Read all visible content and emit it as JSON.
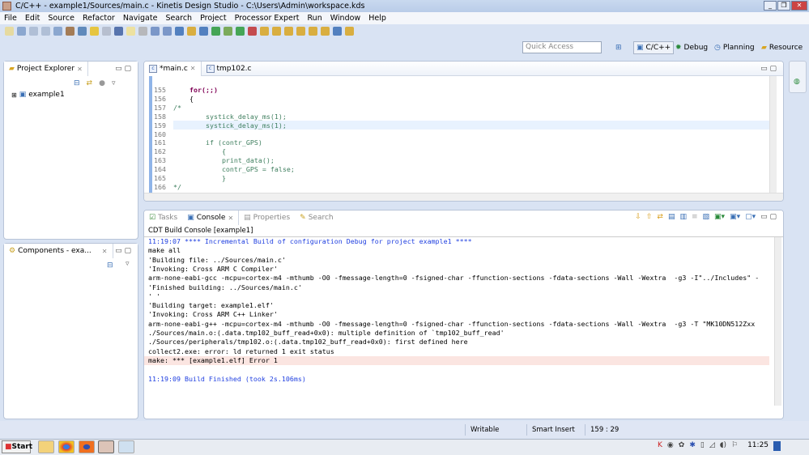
{
  "window": {
    "title": "C/C++ - example1/Sources/main.c - Kinetis Design Studio - C:\\Users\\Admin\\workspace.kds"
  },
  "menu": [
    "File",
    "Edit",
    "Source",
    "Refactor",
    "Navigate",
    "Search",
    "Project",
    "Processor Expert",
    "Run",
    "Window",
    "Help"
  ],
  "quick_access": {
    "placeholder": "Quick Access"
  },
  "perspectives": [
    {
      "label": "C/C++",
      "icon": "cpp-perspective-icon",
      "active": true
    },
    {
      "label": "Debug",
      "icon": "bug-icon"
    },
    {
      "label": "Planning",
      "icon": "clock-icon"
    },
    {
      "label": "Resource",
      "icon": "folder-icon"
    }
  ],
  "project_explorer": {
    "title": "Project Explorer",
    "items": [
      {
        "label": "example1",
        "expanded": false,
        "has_error": true
      }
    ]
  },
  "components": {
    "title": "Components - exa..."
  },
  "editor": {
    "tabs": [
      {
        "label": "*main.c",
        "active": true
      },
      {
        "label": "tmp102.c",
        "active": false
      }
    ],
    "lines": [
      {
        "n": "155",
        "text": "    for(;;)",
        "style": "kw"
      },
      {
        "n": "156",
        "text": "    {",
        "style": "pl"
      },
      {
        "n": "157",
        "text": "/*",
        "style": "cm"
      },
      {
        "n": "158",
        "text": "        systick_delay_ms(1);",
        "style": "cm"
      },
      {
        "n": "159",
        "text": "        systick_delay_ms(1);",
        "style": "cm"
      },
      {
        "n": "160",
        "text": "",
        "style": "cm"
      },
      {
        "n": "161",
        "text": "        if (contr_GPS)",
        "style": "cm"
      },
      {
        "n": "162",
        "text": "            {",
        "style": "cm"
      },
      {
        "n": "163",
        "text": "            print_data();",
        "style": "cm"
      },
      {
        "n": "164",
        "text": "            contr_GPS = false;",
        "style": "cm"
      },
      {
        "n": "165",
        "text": "            }",
        "style": "cm"
      },
      {
        "n": "166",
        "text": "*/",
        "style": "cm"
      }
    ]
  },
  "bottom": {
    "tabs": [
      {
        "label": "Tasks"
      },
      {
        "label": "Console",
        "active": true
      },
      {
        "label": "Properties"
      },
      {
        "label": "Search"
      }
    ],
    "console_title": "CDT Build Console [example1]",
    "lines": [
      {
        "text": "11:19:07 **** Incremental Build of configuration Debug for project example1 ****",
        "kind": "info"
      },
      {
        "text": "make all",
        "kind": "out"
      },
      {
        "text": "'Building file: ../Sources/main.c'",
        "kind": "out"
      },
      {
        "text": "'Invoking: Cross ARM C Compiler'",
        "kind": "out"
      },
      {
        "text": "arm-none-eabi-gcc -mcpu=cortex-m4 -mthumb -O0 -fmessage-length=0 -fsigned-char -ffunction-sections -fdata-sections -Wall -Wextra  -g3 -I\"../Includes\" -",
        "kind": "out"
      },
      {
        "text": "'Finished building: ../Sources/main.c'",
        "kind": "out"
      },
      {
        "text": "' '",
        "kind": "out"
      },
      {
        "text": "'Building target: example1.elf'",
        "kind": "out"
      },
      {
        "text": "'Invoking: Cross ARM C++ Linker'",
        "kind": "out"
      },
      {
        "text": "arm-none-eabi-g++ -mcpu=cortex-m4 -mthumb -O0 -fmessage-length=0 -fsigned-char -ffunction-sections -fdata-sections -Wall -Wextra  -g3 -T \"MK10DN512Zxx",
        "kind": "out"
      },
      {
        "text": "./Sources/main.o:(.data.tmp102_buff_read+0x0): multiple definition of `tmp102_buff_read'",
        "kind": "out"
      },
      {
        "text": "./Sources/peripherals/tmp102.o:(.data.tmp102_buff_read+0x0): first defined here",
        "kind": "out"
      },
      {
        "text": "collect2.exe: error: ld returned 1 exit status",
        "kind": "out"
      },
      {
        "text": "make: *** [example1.elf] Error 1",
        "kind": "error"
      },
      {
        "text": "",
        "kind": "out"
      },
      {
        "text": "11:19:09 Build Finished (took 2s.106ms)",
        "kind": "info"
      }
    ]
  },
  "status": {
    "writable": "Writable",
    "insert_mode": "Smart Insert",
    "position": "159 : 29"
  },
  "taskbar": {
    "start": "Start",
    "clock": "11:25"
  },
  "colors": {
    "accent": "#8fb4e8",
    "info_text": "#1f3fe0",
    "error_bg": "#fbe5e1",
    "current_line": "#e8f2fe"
  }
}
